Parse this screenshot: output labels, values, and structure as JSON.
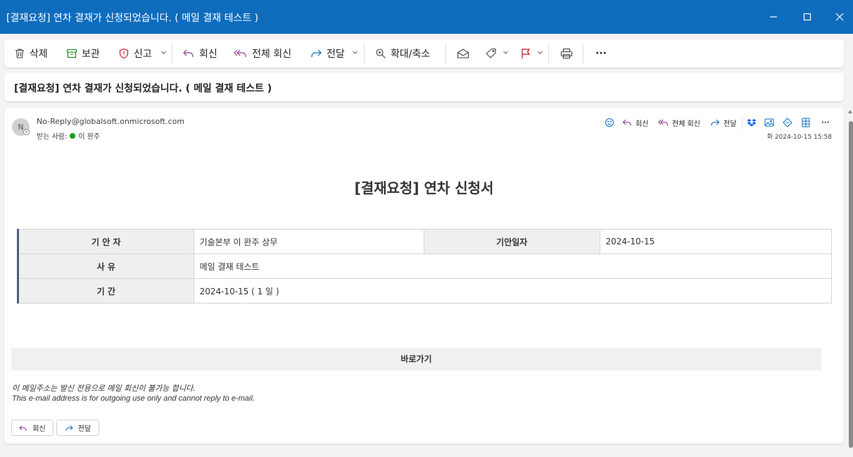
{
  "window": {
    "title": "[결재요청] 연차 결재가 신청되었습니다. ( 메일 결재 테스트 )"
  },
  "toolbar": {
    "delete_label": "삭제",
    "archive_label": "보관",
    "report_label": "신고",
    "reply_label": "회신",
    "reply_all_label": "전체 회신",
    "forward_label": "전달",
    "zoom_label": "확대/축소",
    "more_label": "···"
  },
  "subject": "[결재요청] 연차 결재가 신청되었습니다. ( 메일 결재 테스트 )",
  "message": {
    "avatar_initial": "N",
    "sender": "No-Reply@globalsoft.onmicrosoft.com",
    "to_label": "받는 사람:",
    "to_name": "이 완주",
    "actions": {
      "reply": "회신",
      "reply_all": "전체 회신",
      "forward": "전달",
      "more": "···"
    },
    "date": "화 2024-10-15 15:58"
  },
  "body": {
    "doc_title": "[결재요청] 연차 신청서",
    "table": {
      "drafter_label": "기 안 자",
      "drafter_value": "기술본부 이 완주 상무",
      "draft_date_label": "기안일자",
      "draft_date_value": "2024-10-15",
      "reason_label": "사 유",
      "reason_value": "메일 결재 테스트",
      "period_label": "기 간",
      "period_value": "2024-10-15 ( 1 일 )"
    },
    "shortcut_label": "바로가기",
    "notice_ko": "이 메일주소는 발신 전용으로 메일 회신이 불가능 합니다.",
    "notice_en": "This e-mail address is for outgoing use only and cannot reply to e-mail."
  },
  "quick_actions": {
    "reply": "회신",
    "forward": "전달"
  },
  "colors": {
    "titlebar": "#0f6cbd",
    "reply_icon": "#8a3c8f",
    "forward_icon": "#0f6cbd",
    "archive_icon": "#107c10",
    "report_icon": "#c50f1f",
    "flag_icon": "#c50f1f",
    "presence": "#13a10e",
    "table_accent": "#4a5d86"
  }
}
